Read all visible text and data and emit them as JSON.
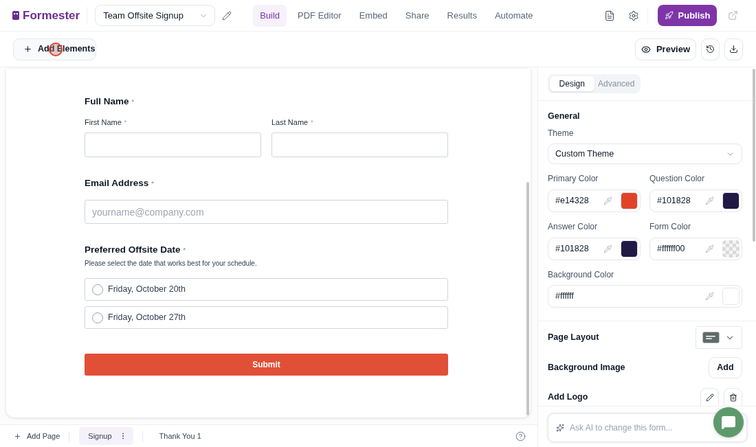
{
  "header": {
    "logo": "Formester",
    "form_name": "Team Offsite Signup",
    "tabs": [
      {
        "label": "Build",
        "selected": true
      },
      {
        "label": "PDF Editor",
        "selected": false
      },
      {
        "label": "Embed",
        "selected": false
      },
      {
        "label": "Share",
        "selected": false
      },
      {
        "label": "Results",
        "selected": false
      },
      {
        "label": "Automate",
        "selected": false
      }
    ],
    "publish_button": "Publish"
  },
  "toolbar": {
    "add_elements_button": "Add Elements",
    "preview_button": "Preview"
  },
  "form": {
    "fields": [
      {
        "kind": "name",
        "label": "Full Name",
        "mark": "*",
        "subfields": [
          {
            "label": "First Name",
            "mark": "*"
          },
          {
            "label": "Last Name",
            "mark": "*"
          }
        ]
      },
      {
        "kind": "email",
        "label": "Email Address",
        "mark": "*",
        "placeholder": "yourname@company.com"
      },
      {
        "kind": "radio",
        "label": "Preferred Offsite Date",
        "mark": "*",
        "description": "Please select the date that works best for your schedule.",
        "options": [
          {
            "label": "Friday, October 20th",
            "selected": false
          },
          {
            "label": "Friday, October 27th",
            "selected": false
          }
        ]
      }
    ],
    "submit_button": "Submit"
  },
  "pages": {
    "add_page_button": "Add Page",
    "tabs": [
      {
        "label": "Signup",
        "selected": true
      },
      {
        "label": "Thank You 1",
        "selected": false
      }
    ]
  },
  "design_panel": {
    "tabs": [
      {
        "label": "Design",
        "selected": true
      },
      {
        "label": "Advanced",
        "selected": false
      }
    ],
    "section_title": "General",
    "theme": {
      "label": "Theme",
      "value": "Custom Theme"
    },
    "colors": [
      {
        "label": "Primary Color",
        "value": "#e14328",
        "kind": "solid",
        "color": "#e14328"
      },
      {
        "label": "Question Color",
        "value": "#101828",
        "kind": "solid",
        "color": "#201a45"
      },
      {
        "label": "Answer Color",
        "value": "#101828",
        "kind": "solid",
        "color": "#201a45"
      },
      {
        "label": "Form Color",
        "value": "#ffffff00",
        "kind": "transparent"
      }
    ],
    "background_color": {
      "label": "Background Color",
      "value": "#ffffff",
      "color": "#ffffff"
    },
    "page_layout": {
      "label": "Page Layout"
    },
    "background_image": {
      "label": "Background Image",
      "button": "Add"
    },
    "logo": {
      "label": "Add Logo"
    },
    "ai_prompt": {
      "placeholder": "Ask AI to change this form..."
    }
  }
}
